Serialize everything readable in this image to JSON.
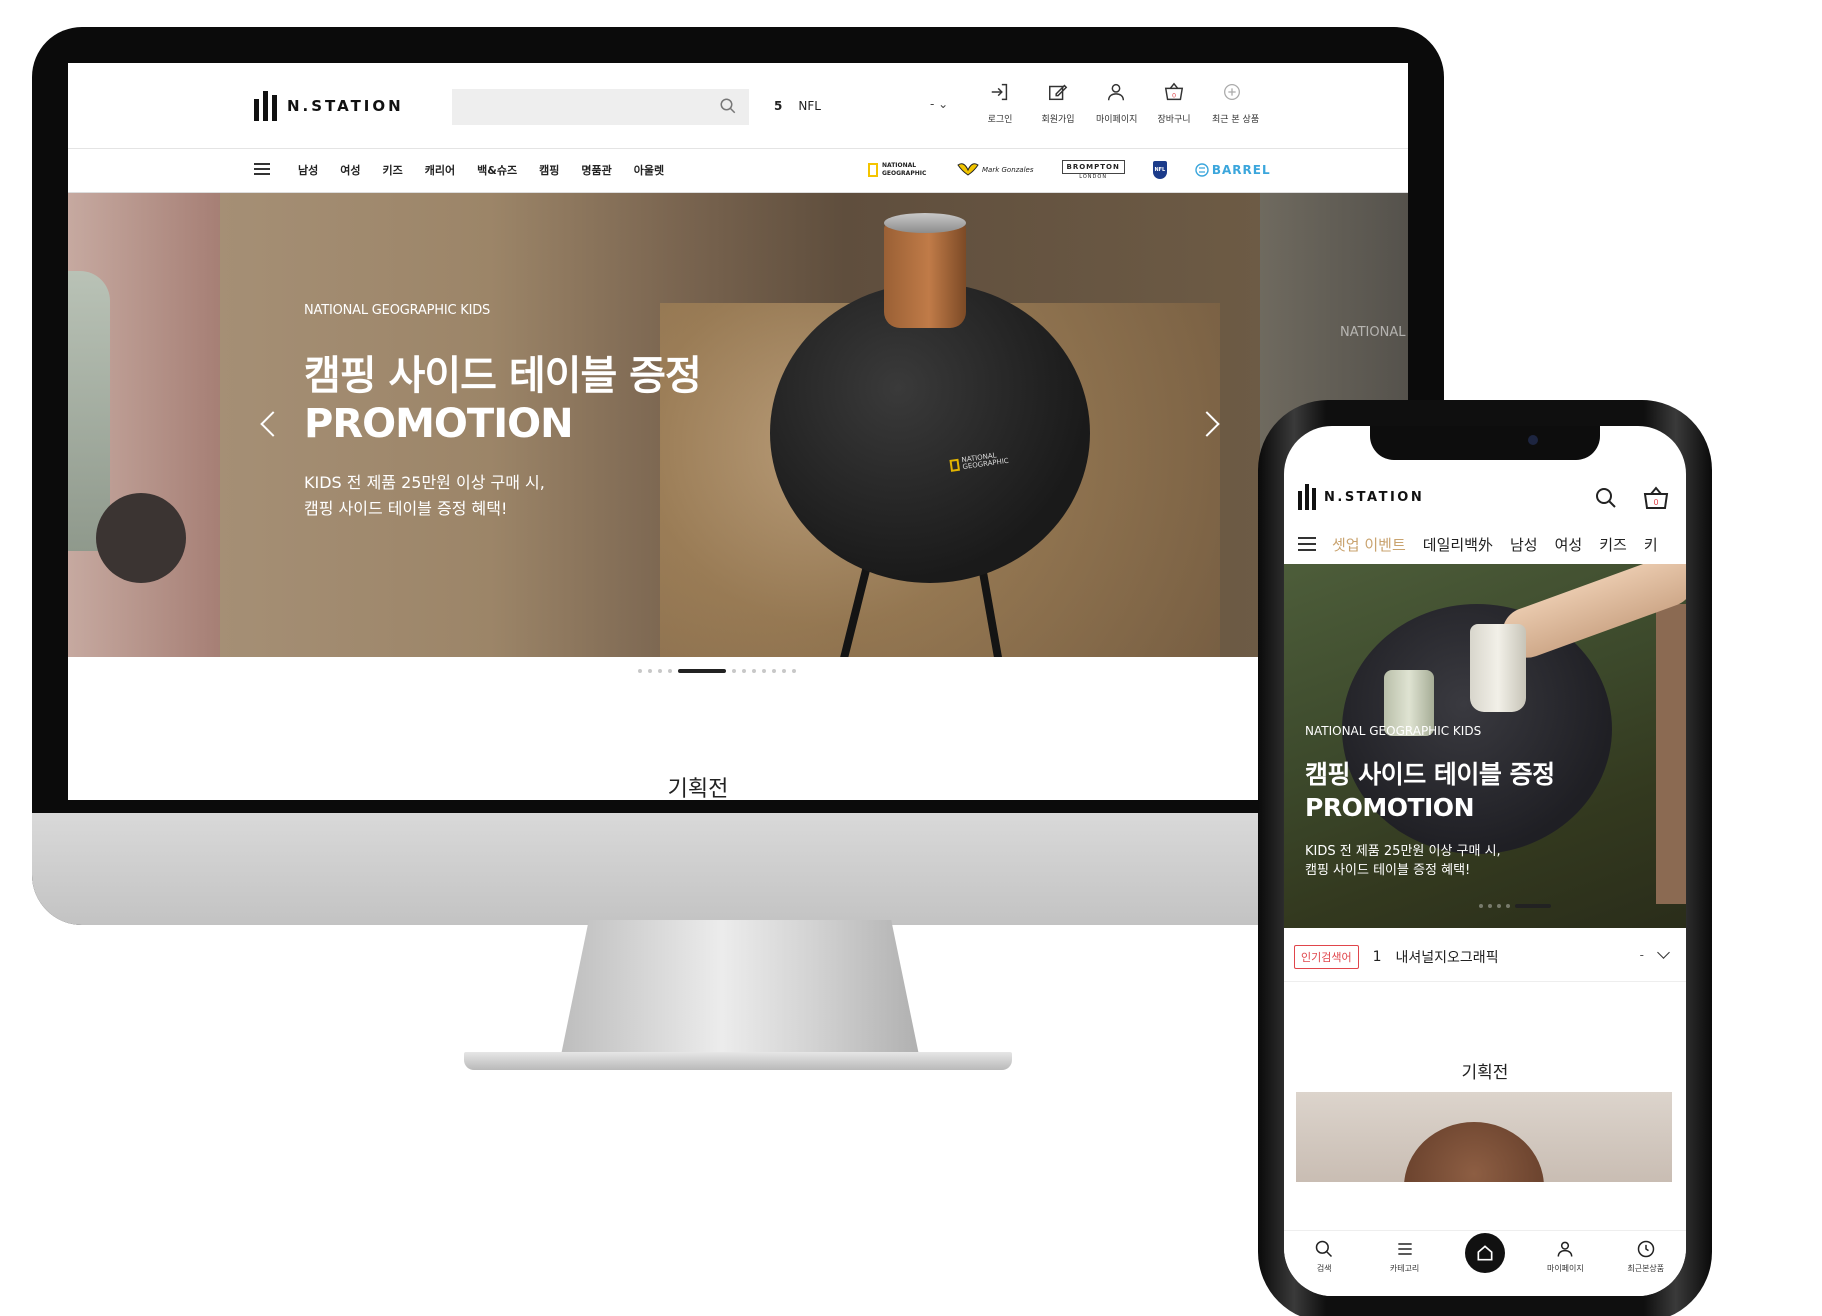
{
  "brand": "N.STATION",
  "desktop": {
    "rank": {
      "number": "5",
      "keyword": "NFL",
      "toggle": "- ⌄"
    },
    "util": [
      "로그인",
      "회원가입",
      "마이페이지",
      "장바구니",
      "최근 본 상품"
    ],
    "cart_count": "0",
    "gnb": [
      "남성",
      "여성",
      "키즈",
      "캐리어",
      "백&슈즈",
      "캠핑",
      "명품관",
      "아울렛"
    ],
    "brands": {
      "ng": "NATIONAL GEOGRAPHIC",
      "brompton": "BROMPTON",
      "brompton_sub": "LONDON",
      "nfl": "NFL",
      "barrel": "BARREL",
      "markgonzales": "Mark Gonzales"
    },
    "hero": {
      "sub": "NATIONAL GEOGRAPHIC KIDS",
      "title_line1": "캠핑 사이드 테이블 증정",
      "title_line2": "PROMOTION",
      "desc_line1": "KIDS 전 제품 25만원 이상 구매 시,",
      "desc_line2": "캠핑 사이드 테이블 증정 혜택!",
      "next_peek": "NATIONAL",
      "table_logo": "NATIONAL GEOGRAPHIC"
    },
    "section_title": "기획전"
  },
  "mobile": {
    "cart_count": "0",
    "nav": [
      "셋업 이벤트",
      "데일리백外",
      "남성",
      "여성",
      "키즈",
      "키"
    ],
    "hero": {
      "sub": "NATIONAL GEOGRAPHIC KIDS",
      "title_line1": "캠핑 사이드 테이블 증정",
      "title_line2": "PROMOTION",
      "desc_line1": "KIDS 전 제품 25만원 이상 구매 시,",
      "desc_line2": "캠핑 사이드 테이블 증정 혜택!"
    },
    "keyword": {
      "badge": "인기검색어",
      "number": "1",
      "text": "내셔널지오그래픽",
      "dash": "-"
    },
    "section_title": "기획전",
    "tabs": [
      "검색",
      "카테고리",
      "",
      "마이페이지",
      "최근본상품"
    ]
  },
  "colors": {
    "accent_gold": "#c9a36f",
    "badge_red": "#e0454b",
    "barrel_blue": "#3ba6dc"
  }
}
